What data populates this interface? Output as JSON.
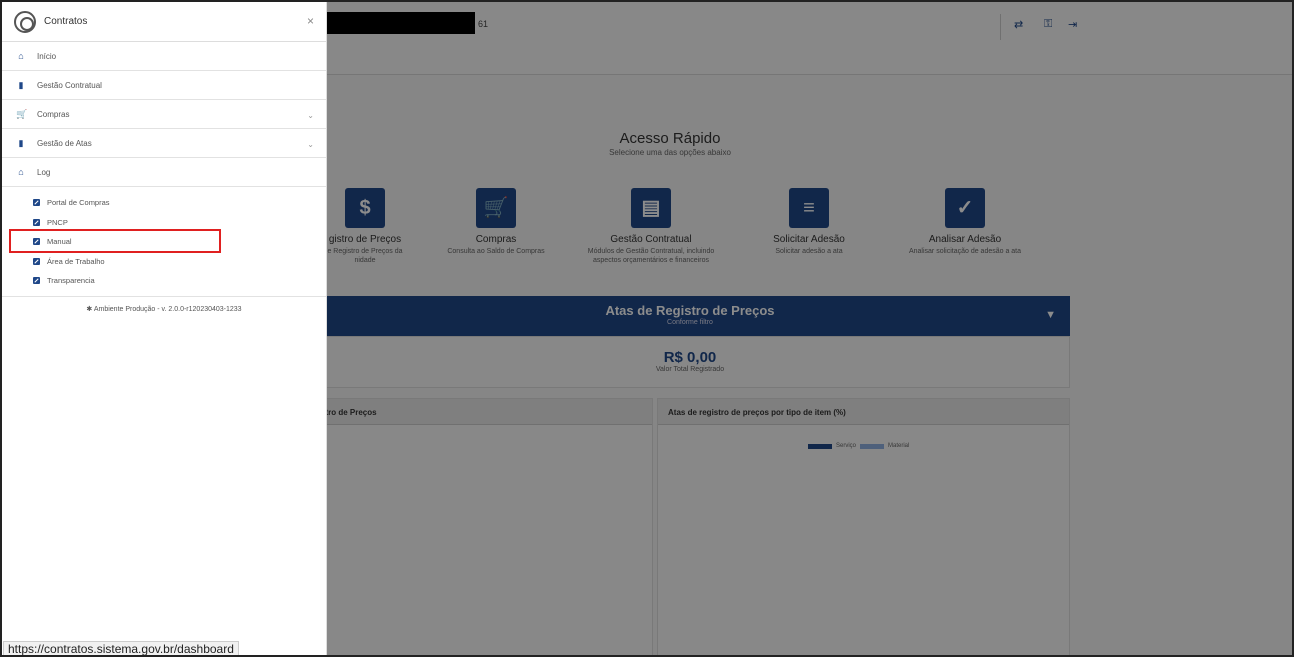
{
  "header": {
    "id_suffix": "61",
    "icons": [
      "transfer-icon",
      "key-icon",
      "logout-icon"
    ]
  },
  "quick_access": {
    "title": "Acesso Rápido",
    "subtitle": "Selecione uma das opções abaixo",
    "items": [
      {
        "label": "gistro de Preços",
        "desc": "e Registro de Preços da\nnidade",
        "icon": "$"
      },
      {
        "label": "Compras",
        "desc": "Consulta ao Saldo de Compras",
        "icon": "🛒"
      },
      {
        "label": "Gestão Contratual",
        "desc": "Módulos de Gestão Contratual, incluindo\naspectos orçamentários e financeiros",
        "icon": "▤"
      },
      {
        "label": "Solicitar Adesão",
        "desc": "Solicitar adesão a ata",
        "icon": "≡"
      },
      {
        "label": "Analisar Adesão",
        "desc": "Analisar solicitação de adesão a ata",
        "icon": "✓"
      }
    ]
  },
  "atas": {
    "title": "Atas de Registro de Preços",
    "subtitle": "Conforme filtro",
    "valor": "R$ 0,00",
    "valor_label": "Valor Total Registrado"
  },
  "cards": {
    "left_title": "stro de Preços",
    "right_title": "Atas de registro de preços por tipo de item (%)",
    "legend": [
      {
        "name": "Serviço",
        "color": "#1f4788"
      },
      {
        "name": "Material",
        "color": "#8fb0e0"
      }
    ]
  },
  "sidebar": {
    "title": "Contratos",
    "close": "×",
    "items": [
      {
        "label": "Início",
        "icon": "home-icon",
        "glyph": "⌂",
        "chevron": false
      },
      {
        "label": "Gestão Contratual",
        "icon": "document-icon",
        "glyph": "▮",
        "chevron": false
      },
      {
        "label": "Compras",
        "icon": "cart-icon",
        "glyph": "🛒",
        "chevron": true
      },
      {
        "label": "Gestão de Atas",
        "icon": "file-icon",
        "glyph": "▮",
        "chevron": true
      },
      {
        "label": "Log",
        "icon": "home-icon",
        "glyph": "⌂",
        "chevron": false
      }
    ],
    "links": [
      {
        "label": "Portal de Compras"
      },
      {
        "label": "PNCP"
      },
      {
        "label": "Manual"
      },
      {
        "label": "Área de Trabalho"
      },
      {
        "label": "Transparencia"
      }
    ],
    "footer": "✱ Ambiente Produção - v. 2.0.0-r120230403-1233"
  },
  "statusbar": {
    "url": "https://contratos.sistema.gov.br/dashboard"
  }
}
